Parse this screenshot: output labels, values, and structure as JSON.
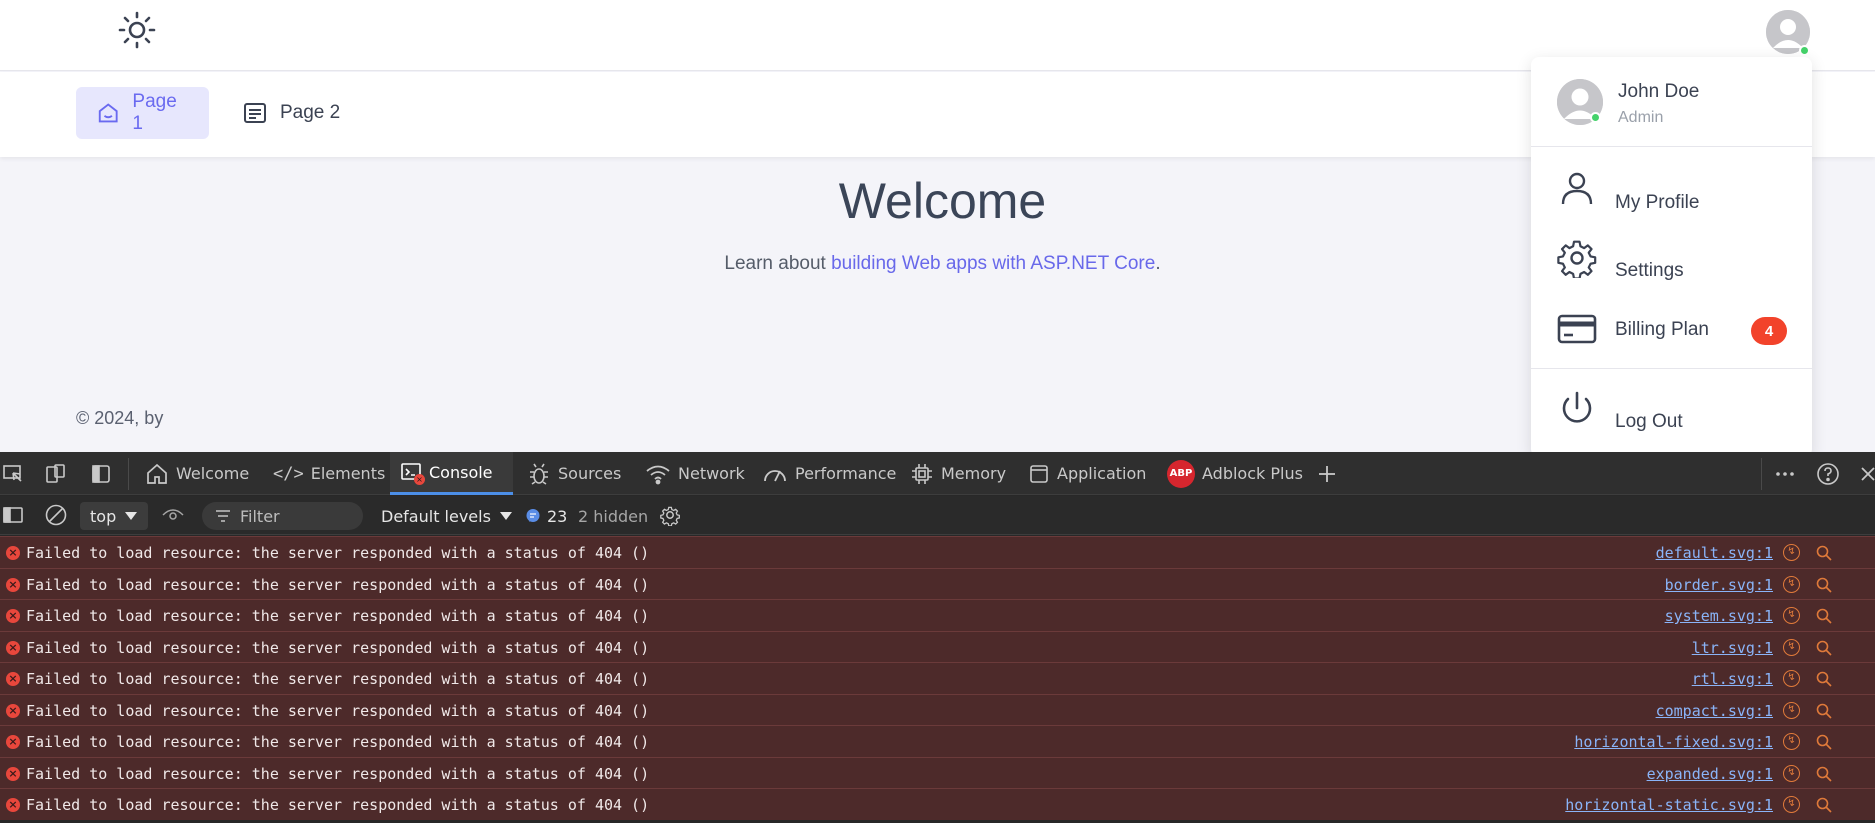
{
  "header": {
    "theme_icon": "sun-icon",
    "avatar_icon": "user-avatar"
  },
  "nav": {
    "items": [
      {
        "label": "Page 1",
        "icon": "home-icon",
        "active": true
      },
      {
        "label": "Page 2",
        "icon": "document-icon",
        "active": false
      }
    ]
  },
  "main": {
    "title": "Welcome",
    "learn_prefix": "Learn about ",
    "learn_link": "building Web apps with ASP.NET Core",
    "learn_suffix": ".",
    "footer": "© 2024, by"
  },
  "user_menu": {
    "name": "John Doe",
    "role": "Admin",
    "items": [
      {
        "label": "My Profile",
        "icon": "user-icon"
      },
      {
        "label": "Settings",
        "icon": "gear-icon"
      },
      {
        "label": "Billing Plan",
        "icon": "credit-card-icon",
        "badge": "4"
      },
      {
        "label": "Log Out",
        "icon": "power-icon"
      }
    ],
    "badge_color": "#f2432b"
  },
  "devtools": {
    "tabs": [
      "Welcome",
      "Elements",
      "Console",
      "Sources",
      "Network",
      "Performance",
      "Memory",
      "Application",
      "Adblock Plus"
    ],
    "active_tab": "Console",
    "abp_label": "ABP",
    "context": "top",
    "filter_placeholder": "Filter",
    "levels": "Default levels",
    "message_count": "23",
    "hidden": "2 hidden",
    "error_message": "Failed to load resource: the server responded with a status of 404 ()",
    "sources": [
      "default.svg:1",
      "border.svg:1",
      "system.svg:1",
      "ltr.svg:1",
      "rtl.svg:1",
      "compact.svg:1",
      "horizontal-fixed.svg:1",
      "expanded.svg:1",
      "horizontal-static.svg:1"
    ],
    "accent": "#4c8fe8"
  }
}
